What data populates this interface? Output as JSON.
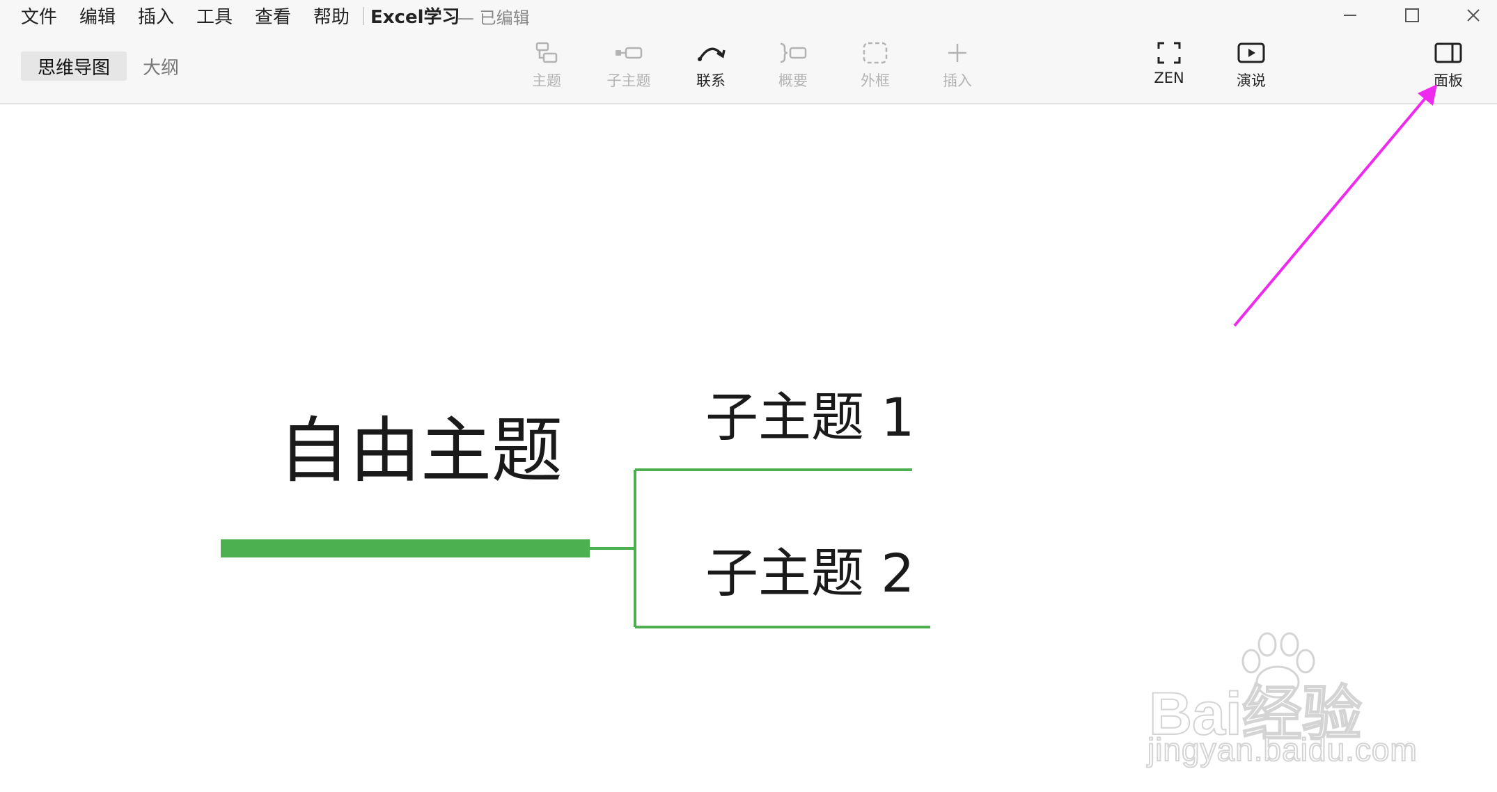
{
  "menu": [
    "文件",
    "编辑",
    "插入",
    "工具",
    "查看",
    "帮助"
  ],
  "document": {
    "title": "Excel学习",
    "status": "— 已编辑"
  },
  "view_tabs": {
    "active": "思维导图",
    "inactive": "大纲"
  },
  "toolbar": {
    "topic": "主题",
    "subtopic": "子主题",
    "relationship": "联系",
    "summary": "概要",
    "boundary": "外框",
    "insert": "插入",
    "zen": "ZEN",
    "present": "演说",
    "panel": "面板"
  },
  "mindmap": {
    "central_topic": "自由主题",
    "subtopics": [
      "子主题 1",
      "子主题 2"
    ]
  },
  "colors": {
    "branch_green": "#4caf50",
    "annotation_arrow": "#ee2aee",
    "disabled_text": "#b3b3b3"
  },
  "watermark": {
    "brand": "Bai经验",
    "site": "jingyan.baidu.com"
  }
}
